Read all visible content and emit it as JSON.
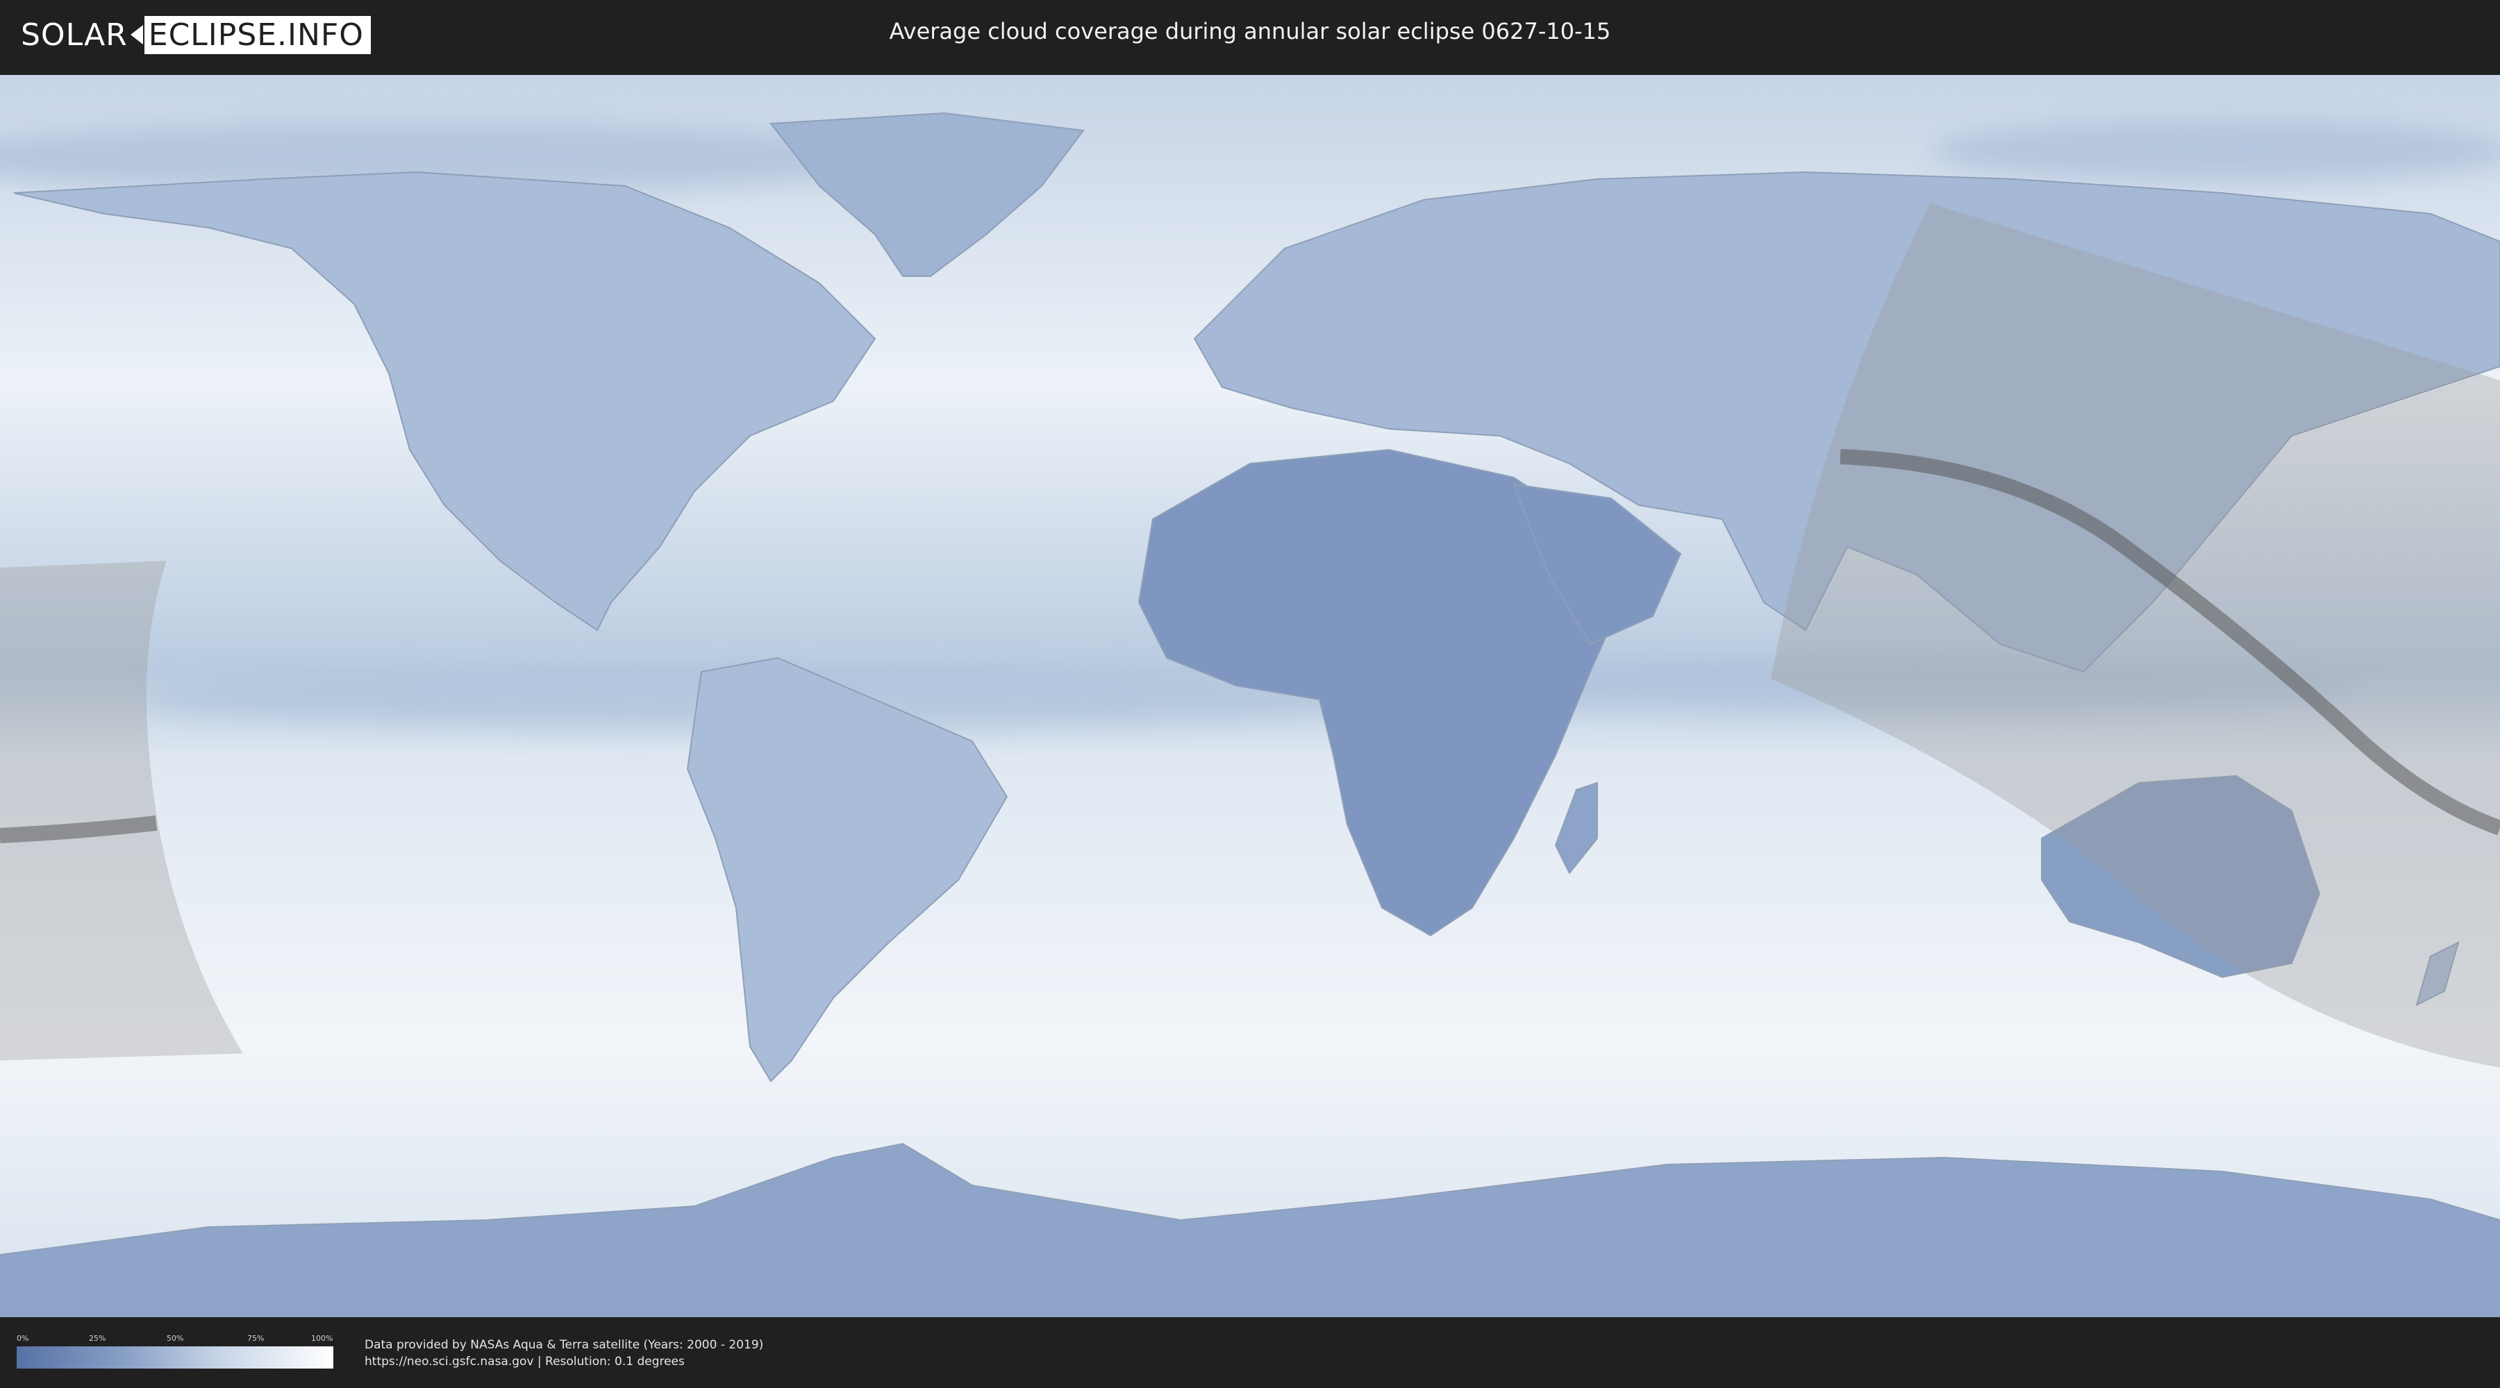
{
  "header": {
    "logo_left": "SOLAR",
    "logo_right": "ECLIPSE.INFO",
    "title": "Average cloud coverage during annular solar eclipse 0627-10-15"
  },
  "legend": {
    "ticks": [
      "0%",
      "25%",
      "50%",
      "75%",
      "100%"
    ],
    "gradient_colors": [
      "#5671a6",
      "#8aa1c6",
      "#c9d6e8",
      "#ffffff"
    ]
  },
  "credits": {
    "line1": "Data provided by NASAs Aqua & Terra satellite (Years: 2000 - 2019)",
    "line2": "https://neo.sci.gsfc.nasa.gov | Resolution: 0.1 degrees"
  },
  "map": {
    "projection": "equirectangular",
    "ocean_color": "#dfe8f2",
    "land_clear_color": "#6e88b6",
    "eclipse_shade_color": "#9a9a9a",
    "eclipse_path_color": "#5a5a5a"
  }
}
